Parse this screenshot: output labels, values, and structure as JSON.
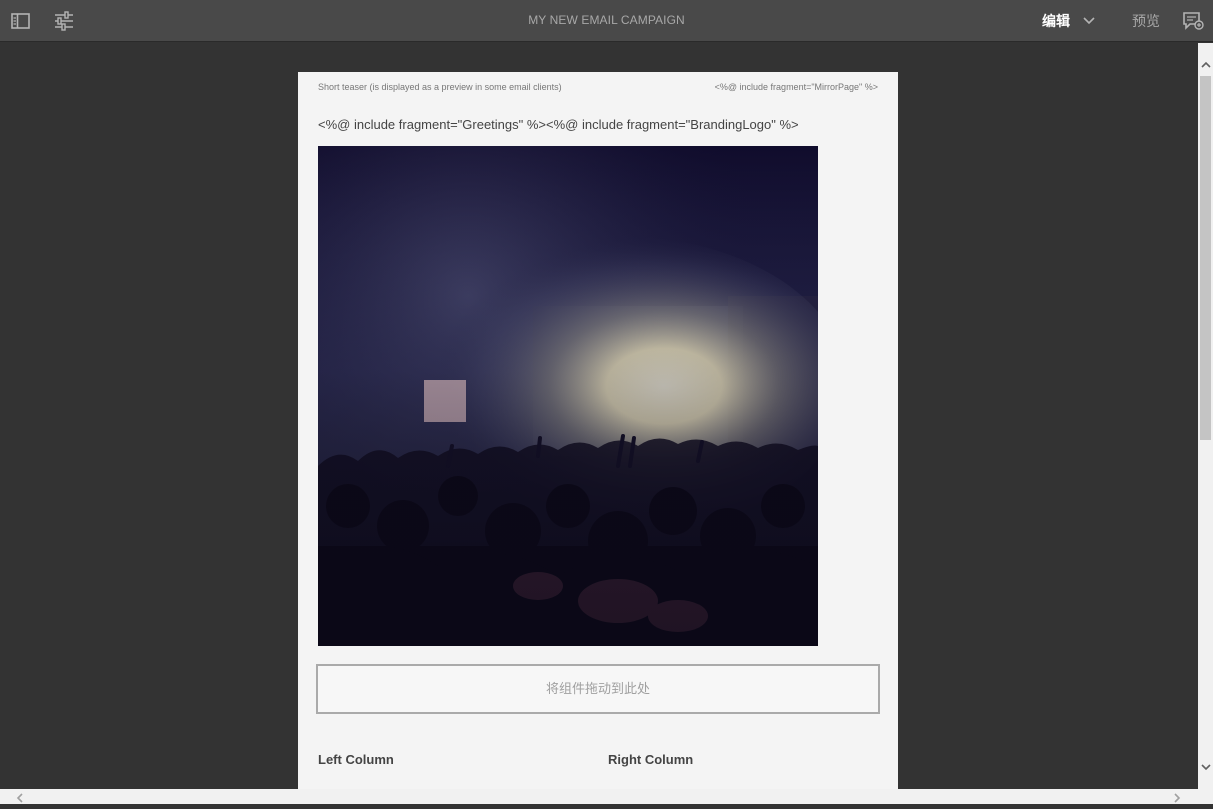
{
  "toolbar": {
    "title": "MY NEW EMAIL CAMPAIGN",
    "mode_label": "编辑",
    "preview_label": "预览",
    "icons": {
      "side_panel": "side-panel-icon",
      "properties": "sliders-icon",
      "mode_dropdown": "chevron-down-icon",
      "annotations": "comment-add-icon"
    }
  },
  "email": {
    "teaser_text": "Short teaser (is displayed as a preview in some email clients)",
    "mirror_text": "<%@ include fragment=\"MirrorPage\" %>",
    "greeting_text": "<%@ include fragment=\"Greetings\" %><%@ include fragment=\"BrandingLogo\" %>",
    "hero_image": "concert-crowd-image",
    "dropzone_text": "将组件拖动到此处",
    "left_column_title": "Left Column",
    "right_column_title": "Right Column"
  },
  "colors": {
    "toolbar_bg": "#494949",
    "canvas_bg": "#333333",
    "email_bg": "#f4f4f4",
    "active_mode": "#ffffff",
    "inactive_mode": "#a8a8a8"
  }
}
